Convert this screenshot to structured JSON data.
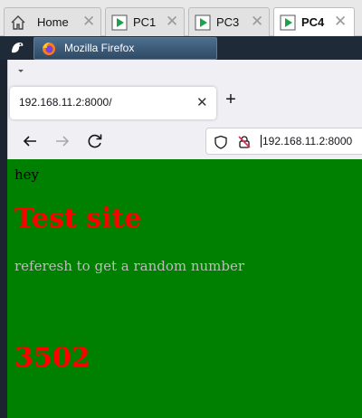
{
  "vm_tabs": [
    {
      "label": "Home",
      "icon": "home-icon",
      "active": false
    },
    {
      "label": "PC1",
      "icon": "vm-play-icon",
      "active": false
    },
    {
      "label": "PC3",
      "icon": "vm-play-icon",
      "active": false
    },
    {
      "label": "PC4",
      "icon": "vm-play-icon",
      "active": true
    }
  ],
  "taskbar": {
    "window_title": "Mozilla Firefox"
  },
  "browser": {
    "tab_title": "192.168.11.2:8000/",
    "url": "192.168.11.2:8000",
    "new_tab_symbol": "+",
    "close_symbol": "✕"
  },
  "page": {
    "greeting": "hey",
    "heading": "Test site",
    "subtitle": "referesh to get a random number",
    "random_number": "3502",
    "background_color": "#008000",
    "heading_color": "#ff0000"
  }
}
